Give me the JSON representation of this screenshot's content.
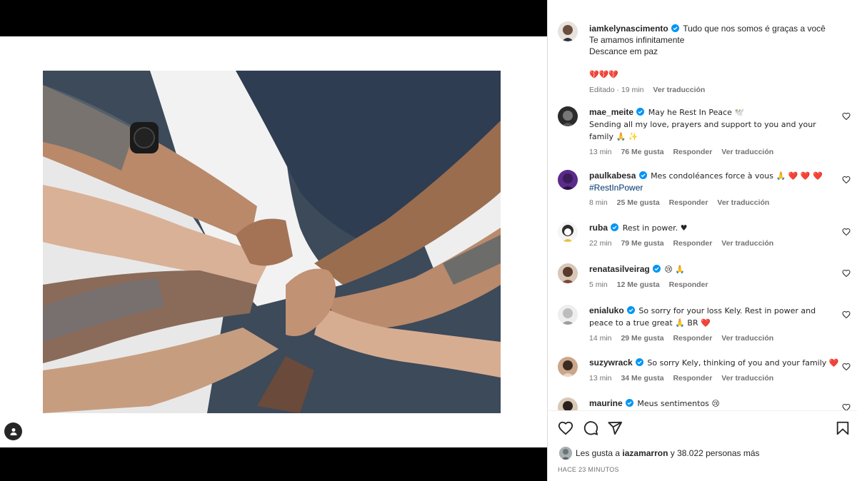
{
  "post": {
    "tag_icon": "person-tag-icon",
    "image_alt": "Hands stacked together over a hospital bed"
  },
  "caption": {
    "username": "iamkelynascimento",
    "line1": "Tudo que nos somos é graças a você",
    "line2": "Te amamos infinitamente",
    "line3": "Descance em paz",
    "emojis": "💔💔💔",
    "edited": "Editado · 19 min",
    "translate": "Ver traducción"
  },
  "comments": [
    {
      "username": "mae_meite",
      "text": "May he Rest In Peace 🕊️",
      "text2": "Sending all my love, prayers and support to you and your family 🙏 ✨",
      "time": "13 min",
      "likes": "76 Me gusta",
      "reply": "Responder",
      "translate": "Ver traducción"
    },
    {
      "username": "paulkabesa",
      "text": "Mes condoléances force à vous 🙏 ❤️ ❤️ ❤️",
      "hashtag": "#RestInPower",
      "time": "8 min",
      "likes": "25 Me gusta",
      "reply": "Responder",
      "translate": "Ver traducción"
    },
    {
      "username": "ruba",
      "text": "Rest in power. ♥",
      "time": "22 min",
      "likes": "79 Me gusta",
      "reply": "Responder",
      "translate": "Ver traducción"
    },
    {
      "username": "renatasilveirag",
      "text": "😢 🙏",
      "time": "5 min",
      "likes": "12 Me gusta",
      "reply": "Responder"
    },
    {
      "username": "enialuko",
      "text": "So sorry for your loss Kely. Rest in power and",
      "text2": "peace to a true great 🙏 BR ❤️",
      "time": "14 min",
      "likes": "29 Me gusta",
      "reply": "Responder",
      "translate": "Ver traducción"
    },
    {
      "username": "suzywrack",
      "text": "So sorry Kely, thinking of you and your family ❤️",
      "time": "13 min",
      "likes": "34 Me gusta",
      "reply": "Responder",
      "translate": "Ver traducción"
    },
    {
      "username": "maurine",
      "text": "Meus sentimentos 😢"
    }
  ],
  "actions": {
    "like_icon": "heart-icon",
    "comment_icon": "comment-icon",
    "share_icon": "send-icon",
    "save_icon": "bookmark-icon"
  },
  "likes": {
    "prefix": "Les gusta a",
    "user": "iazamarron",
    "suffix": "y 38.022 personas más"
  },
  "timeago": "HACE 23 MINUTOS",
  "colors": {
    "verified": "#0095f6",
    "hashtag": "#00376b",
    "muted": "#737373"
  }
}
